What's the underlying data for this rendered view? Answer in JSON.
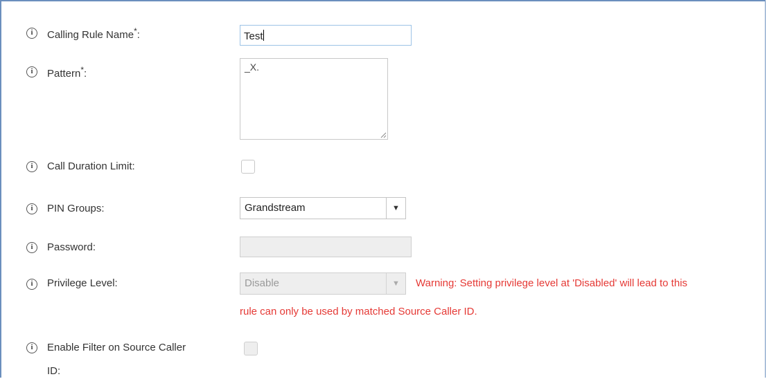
{
  "form": {
    "calling_rule_name": {
      "label": "Calling Rule Name",
      "required_mark": "*",
      "suffix": ":",
      "value": "Test"
    },
    "pattern": {
      "label": "Pattern",
      "required_mark": "*",
      "suffix": ":",
      "value": "_X."
    },
    "call_duration_limit": {
      "label": "Call Duration Limit:",
      "checked": false
    },
    "pin_groups": {
      "label": "PIN Groups:",
      "selected": "Grandstream"
    },
    "password": {
      "label": "Password:",
      "value": ""
    },
    "privilege_level": {
      "label": "Privilege Level:",
      "selected": "Disable",
      "warning_line1": "Warning: Setting privilege level at 'Disabled' will lead to this",
      "warning_line2": "rule can only be used by matched Source Caller ID."
    },
    "enable_filter": {
      "label_line1": "Enable Filter on Source Caller",
      "label_line2": "ID:",
      "checked": false
    }
  },
  "icons": {
    "info": "info-circle-icon",
    "dropdown": "triangle-down-icon",
    "resize": "resize-grip-icon"
  },
  "colors": {
    "frame": "#6b8fbd",
    "focus_border": "#9cc3e6",
    "warning": "#e53935",
    "disabled_bg": "#eeeeee"
  }
}
